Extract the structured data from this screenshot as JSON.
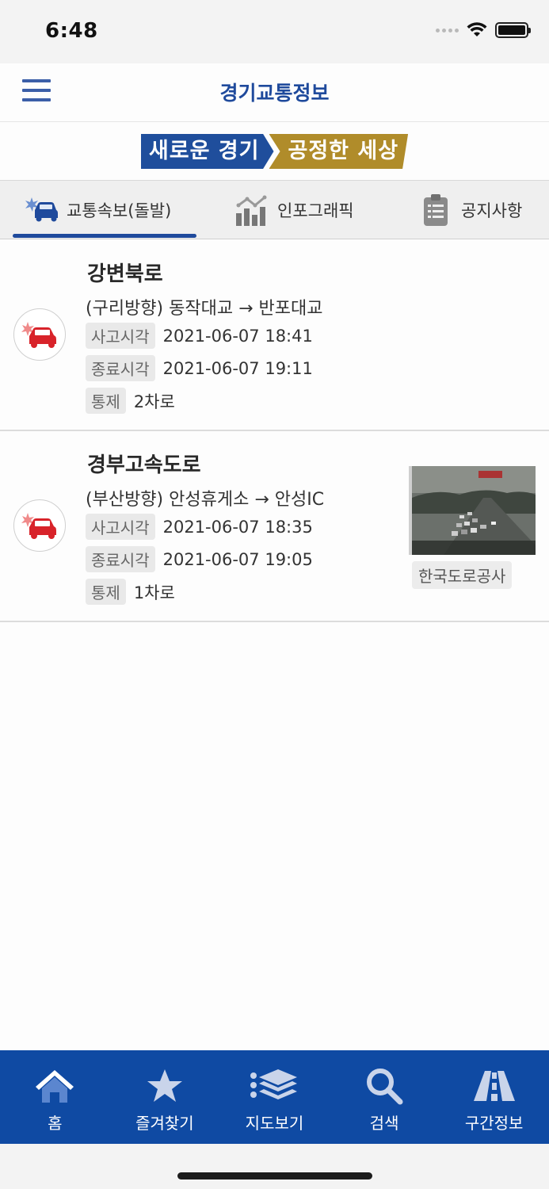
{
  "status_bar": {
    "time": "6:48"
  },
  "header": {
    "title": "경기교통정보"
  },
  "banner": {
    "left": "새로운 경기",
    "right": "공정한 세상"
  },
  "tabs": [
    {
      "label": "교통속보(돌발)",
      "icon": "car-crash-icon",
      "active": true
    },
    {
      "label": "인포그래픽",
      "icon": "chart-icon",
      "active": false
    },
    {
      "label": "공지사항",
      "icon": "clipboard-icon",
      "active": false
    }
  ],
  "alerts": [
    {
      "road": "강변북로",
      "route": "(구리방향) 동작대교 → 반포대교",
      "start_label": "사고시각",
      "start_time": "2021-06-07 18:41",
      "end_label": "종료시각",
      "end_time": "2021-06-07 19:11",
      "control_label": "통제",
      "control": "2차로"
    },
    {
      "road": "경부고속도로",
      "route": "(부산방향) 안성휴게소 → 안성IC",
      "start_label": "사고시각",
      "start_time": "2021-06-07 18:35",
      "end_label": "종료시각",
      "end_time": "2021-06-07 19:05",
      "control_label": "통제",
      "control": "1차로",
      "cctv_source": "한국도로공사"
    }
  ],
  "bottom_nav": [
    {
      "label": "홈",
      "icon": "home-icon"
    },
    {
      "label": "즐겨찾기",
      "icon": "star-icon"
    },
    {
      "label": "지도보기",
      "icon": "layers-icon"
    },
    {
      "label": "검색",
      "icon": "search-icon"
    },
    {
      "label": "구간정보",
      "icon": "road-icon"
    }
  ],
  "colors": {
    "primary": "#1f4a9c",
    "nav_bg": "#0f4aa3",
    "accent_gold": "#b08c2a",
    "crash_red": "#d8232a"
  }
}
